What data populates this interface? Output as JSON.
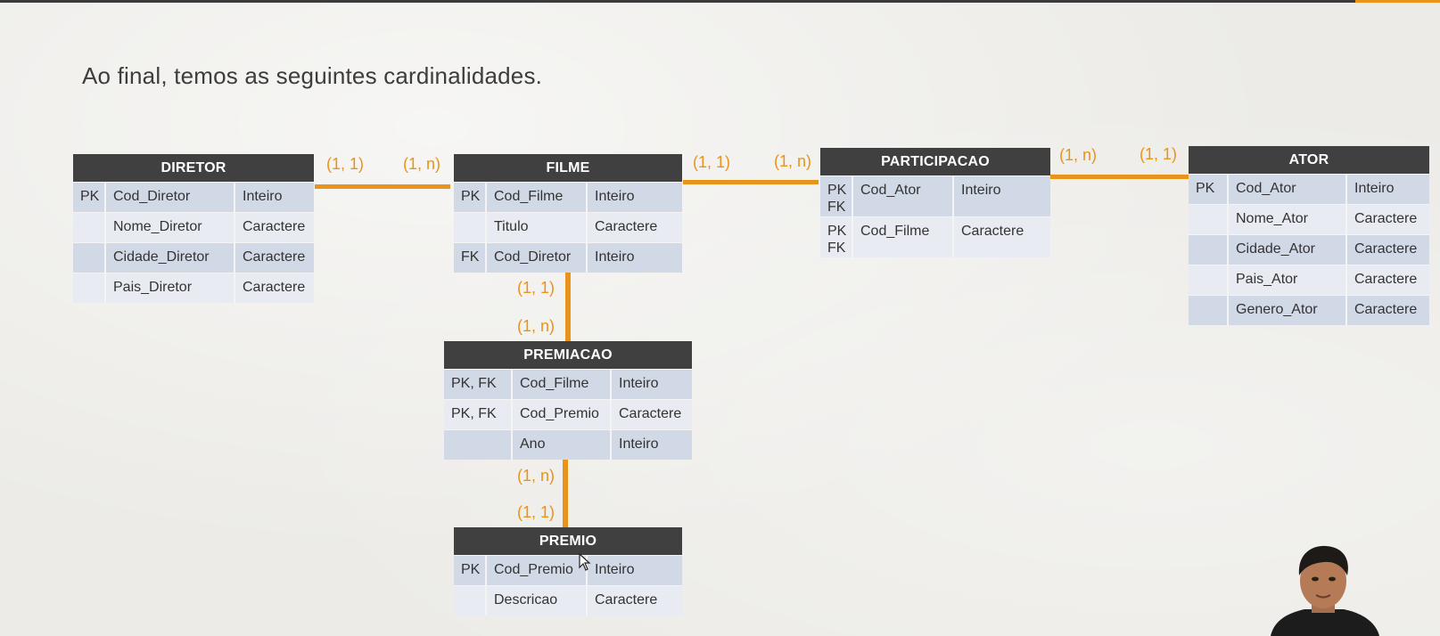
{
  "slide": {
    "title": "Ao final, temos as seguintes cardinalidades."
  },
  "colors": {
    "accent": "#e8931a",
    "header": "#404040",
    "row_odd": "#d2d9e6",
    "row_even": "#e8ebf2"
  },
  "entities": {
    "diretor": {
      "name": "DIRETOR",
      "rows": [
        {
          "key": "PK",
          "field": "Cod_Diretor",
          "type": "Inteiro"
        },
        {
          "key": "",
          "field": "Nome_Diretor",
          "type": "Caractere"
        },
        {
          "key": "",
          "field": "Cidade_Diretor",
          "type": "Caractere"
        },
        {
          "key": "",
          "field": "Pais_Diretor",
          "type": "Caractere"
        }
      ]
    },
    "filme": {
      "name": "FILME",
      "rows": [
        {
          "key": "PK",
          "field": "Cod_Filme",
          "type": "Inteiro"
        },
        {
          "key": "",
          "field": "Titulo",
          "type": "Caractere"
        },
        {
          "key": "FK",
          "field": "Cod_Diretor",
          "type": "Inteiro"
        }
      ]
    },
    "participacao": {
      "name": "PARTICIPACAO",
      "rows": [
        {
          "key": "PK\nFK",
          "field": "Cod_Ator",
          "type": "Inteiro"
        },
        {
          "key": "PK\nFK",
          "field": "Cod_Filme",
          "type": "Caractere"
        }
      ]
    },
    "ator": {
      "name": "ATOR",
      "rows": [
        {
          "key": "PK",
          "field": "Cod_Ator",
          "type": "Inteiro"
        },
        {
          "key": "",
          "field": "Nome_Ator",
          "type": "Caractere"
        },
        {
          "key": "",
          "field": "Cidade_Ator",
          "type": "Caractere"
        },
        {
          "key": "",
          "field": "Pais_Ator",
          "type": "Caractere"
        },
        {
          "key": "",
          "field": "Genero_Ator",
          "type": "Caractere"
        }
      ]
    },
    "premiacao": {
      "name": "PREMIACAO",
      "rows": [
        {
          "key": "PK, FK",
          "field": "Cod_Filme",
          "type": "Inteiro"
        },
        {
          "key": "PK, FK",
          "field": "Cod_Premio",
          "type": "Caractere"
        },
        {
          "key": "",
          "field": "Ano",
          "type": "Inteiro"
        }
      ]
    },
    "premio": {
      "name": "PREMIO",
      "rows": [
        {
          "key": "PK",
          "field": "Cod_Premio",
          "type": "Inteiro"
        },
        {
          "key": "",
          "field": "Descricao",
          "type": "Caractere"
        }
      ]
    }
  },
  "cardinalities": {
    "diretor_filme_left": "(1, 1)",
    "diretor_filme_right": "(1, n)",
    "filme_participacao_left": "(1, 1)",
    "filme_participacao_right": "(1, n)",
    "participacao_ator_left": "(1, n)",
    "participacao_ator_right": "(1, 1)",
    "filme_premiacao_top": "(1, 1)",
    "filme_premiacao_bottom": "(1, n)",
    "premiacao_premio_top": "(1, n)",
    "premiacao_premio_bottom": "(1, 1)"
  }
}
